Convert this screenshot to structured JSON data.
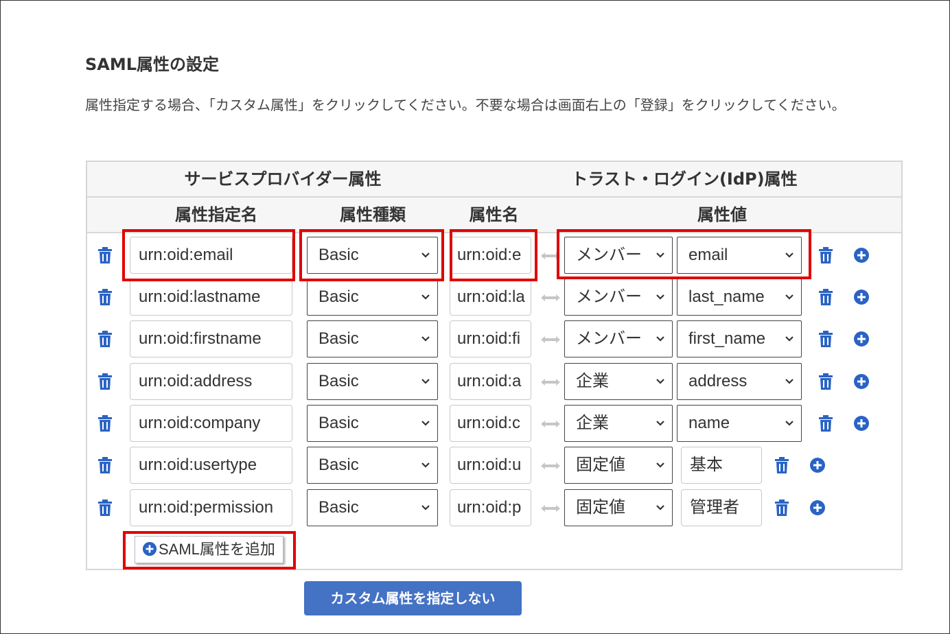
{
  "section": {
    "title": "SAML属性の設定",
    "description": "属性指定する場合、「カスタム属性」をクリックしてください。不要な場合は画面右上の「登録」をクリックしてください。"
  },
  "table": {
    "group_headers": {
      "sp": "サービスプロバイダー属性",
      "idp": "トラスト・ログイン(IdP)属性"
    },
    "column_headers": {
      "attr_spec_name": "属性指定名",
      "attr_type": "属性種類",
      "attr_name": "属性名",
      "attr_value": "属性値"
    },
    "rows": [
      {
        "spec_name": "urn:oid:email",
        "type": "Basic",
        "name": "urn:oid:e",
        "source": "メンバー",
        "value": "email",
        "value_kind": "select"
      },
      {
        "spec_name": " urn:oid:lastname",
        "type": "Basic",
        "name": "urn:oid:la",
        "source": "メンバー",
        "value": "last_name",
        "value_kind": "select"
      },
      {
        "spec_name": " urn:oid:firstname",
        "type": "Basic",
        "name": "urn:oid:fi",
        "source": "メンバー",
        "value": "first_name",
        "value_kind": "select"
      },
      {
        "spec_name": "urn:oid:address",
        "type": "Basic",
        "name": "urn:oid:a",
        "source": "企業",
        "value": "address",
        "value_kind": "select"
      },
      {
        "spec_name": "urn:oid:company",
        "type": "Basic",
        "name": "urn:oid:c",
        "source": "企業",
        "value": "name",
        "value_kind": "select"
      },
      {
        "spec_name": "urn:oid:usertype",
        "type": "Basic",
        "name": "urn:oid:u",
        "source": "固定値",
        "value": "基本",
        "value_kind": "text"
      },
      {
        "spec_name": " urn:oid:permission",
        "type": "Basic",
        "name": " urn:oid:p",
        "source": "固定値",
        "value": "管理者",
        "value_kind": "text"
      }
    ]
  },
  "buttons": {
    "add_attribute": "SAML属性を追加",
    "no_custom": "カスタム属性を指定しない"
  },
  "icons": {
    "delete": "trash-icon",
    "add": "plus-circle-icon",
    "mapping": "double-arrow-icon",
    "dropdown": "chevron-down-icon"
  },
  "colors": {
    "accent_blue": "#4472c4",
    "icon_blue": "#2a63c4",
    "highlight_red": "#e00000"
  }
}
